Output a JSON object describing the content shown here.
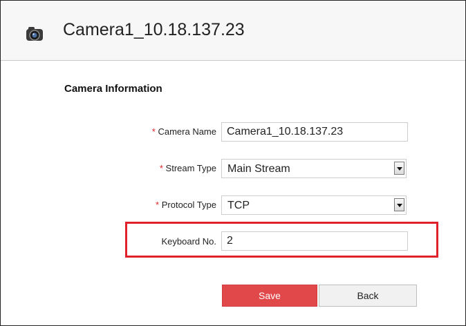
{
  "header": {
    "title": "Camera1_10.18.137.23",
    "icon": "camera-icon"
  },
  "section": {
    "title": "Camera Information"
  },
  "form": {
    "required_mark": "*",
    "camera_name": {
      "label": "Camera Name",
      "value": "Camera1_10.18.137.23"
    },
    "stream_type": {
      "label": "Stream Type",
      "value": "Main Stream"
    },
    "protocol_type": {
      "label": "Protocol Type",
      "value": "TCP"
    },
    "keyboard_no": {
      "label": "Keyboard No.",
      "value": "2"
    }
  },
  "buttons": {
    "save": "Save",
    "back": "Back"
  },
  "colors": {
    "required": "#e02020",
    "highlight_border": "#e0202b",
    "save_button": "#e0484a",
    "back_button": "#f1f1f1"
  }
}
